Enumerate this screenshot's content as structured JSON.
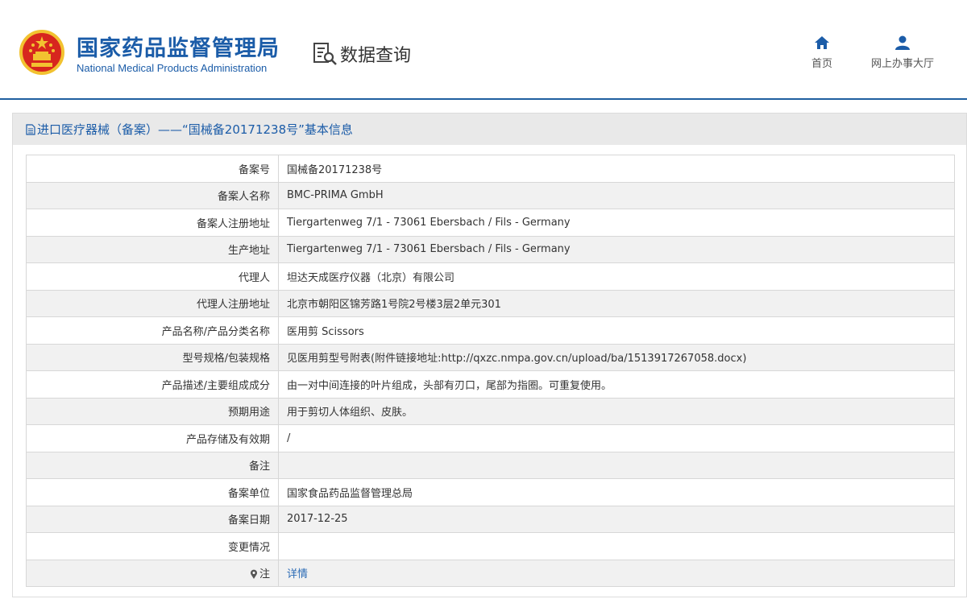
{
  "header": {
    "title_cn": "国家药品监督管理局",
    "title_en": "National Medical Products Administration",
    "query_label": "数据查询"
  },
  "nav": {
    "home": "首页",
    "hall": "网上办事大厅"
  },
  "panel": {
    "title": "进口医疗器械（备案）——“国械备20171238号”基本信息"
  },
  "rows": [
    {
      "label": "备案号",
      "value": "国械备20171238号"
    },
    {
      "label": "备案人名称",
      "value": "BMC-PRIMA GmbH"
    },
    {
      "label": "备案人注册地址",
      "value": "Tiergartenweg 7/1 - 73061 Ebersbach / Fils - Germany"
    },
    {
      "label": "生产地址",
      "value": "Tiergartenweg 7/1 - 73061 Ebersbach / Fils - Germany"
    },
    {
      "label": "代理人",
      "value": "坦达天成医疗仪器（北京）有限公司"
    },
    {
      "label": "代理人注册地址",
      "value": "北京市朝阳区锦芳路1号院2号楼3层2单元301"
    },
    {
      "label": "产品名称/产品分类名称",
      "value": "医用剪 Scissors"
    },
    {
      "label": "型号规格/包装规格",
      "value": "见医用剪型号附表(附件链接地址:http://qxzc.nmpa.gov.cn/upload/ba/1513917267058.docx)"
    },
    {
      "label": "产品描述/主要组成成分",
      "value": "由一对中间连接的叶片组成，头部有刃口，尾部为指圈。可重复使用。"
    },
    {
      "label": "预期用途",
      "value": "用于剪切人体组织、皮肤。"
    },
    {
      "label": "产品存储及有效期",
      "value": "/"
    },
    {
      "label": "备注",
      "value": ""
    },
    {
      "label": "备案单位",
      "value": "国家食品药品监督管理总局"
    },
    {
      "label": "备案日期",
      "value": "2017-12-25"
    },
    {
      "label": "变更情况",
      "value": ""
    }
  ],
  "note": {
    "label": "注",
    "link": "详情"
  },
  "colors": {
    "brand_blue": "#1b5ca8",
    "emblem_red": "#d7261e",
    "emblem_gold": "#f2c230",
    "link_blue": "#2a6ab5"
  },
  "icons": [
    "national-emblem-icon",
    "data-query-icon",
    "home-icon",
    "user-icon",
    "document-icon",
    "pin-icon"
  ]
}
